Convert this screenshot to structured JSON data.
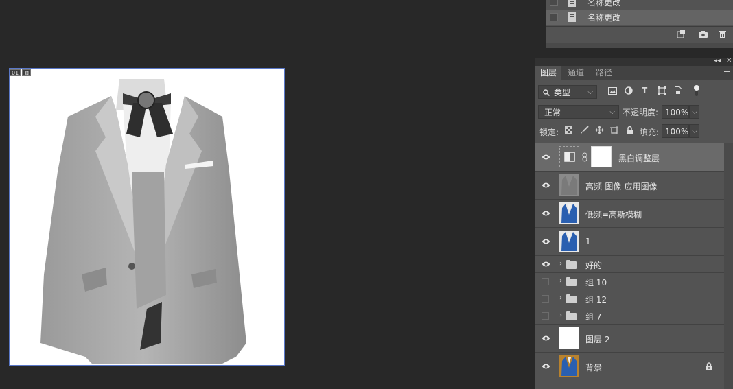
{
  "document": {
    "badges": [
      "01",
      "⊠"
    ]
  },
  "history": {
    "items": [
      {
        "label": "名称更改"
      },
      {
        "label": "名称更改",
        "selected": true
      }
    ],
    "footer_icons": [
      "new-snapshot-icon",
      "camera-icon",
      "trash-icon"
    ]
  },
  "layers_panel": {
    "tabs": [
      "图层",
      "通道",
      "路径"
    ],
    "active_tab": "图层",
    "filter": {
      "kind_label": "类型",
      "icons": [
        "image-filter-icon",
        "adjustment-filter-icon",
        "type-filter-icon",
        "shape-filter-icon",
        "smart-object-filter-icon",
        "filter-toggle-icon"
      ]
    },
    "blend_mode": "正常",
    "opacity_label": "不透明度:",
    "opacity_value": "100%",
    "lock_label": "锁定:",
    "lock_icons": [
      "lock-transparent-icon",
      "lock-pixels-icon",
      "lock-position-icon",
      "lock-artboard-icon",
      "lock-all-icon"
    ],
    "fill_label": "填充:",
    "fill_value": "100%",
    "layers": [
      {
        "name": "黑白调整层",
        "type": "adjustment",
        "visible": true,
        "selected": true
      },
      {
        "name": "高频-图像-应用图像",
        "type": "gray-suit",
        "visible": true
      },
      {
        "name": "低频=高斯模糊",
        "type": "blue-suit",
        "visible": true
      },
      {
        "name": "1",
        "type": "blue-suit",
        "visible": true
      },
      {
        "name": "好的",
        "type": "group",
        "visible": true
      },
      {
        "name": "组 10",
        "type": "group",
        "visible": false
      },
      {
        "name": "组 12",
        "type": "group",
        "visible": false
      },
      {
        "name": "组 7",
        "type": "group",
        "visible": false
      },
      {
        "name": "图层 2",
        "type": "white",
        "visible": true
      },
      {
        "name": "背景",
        "type": "background",
        "visible": true,
        "locked": true
      }
    ]
  }
}
